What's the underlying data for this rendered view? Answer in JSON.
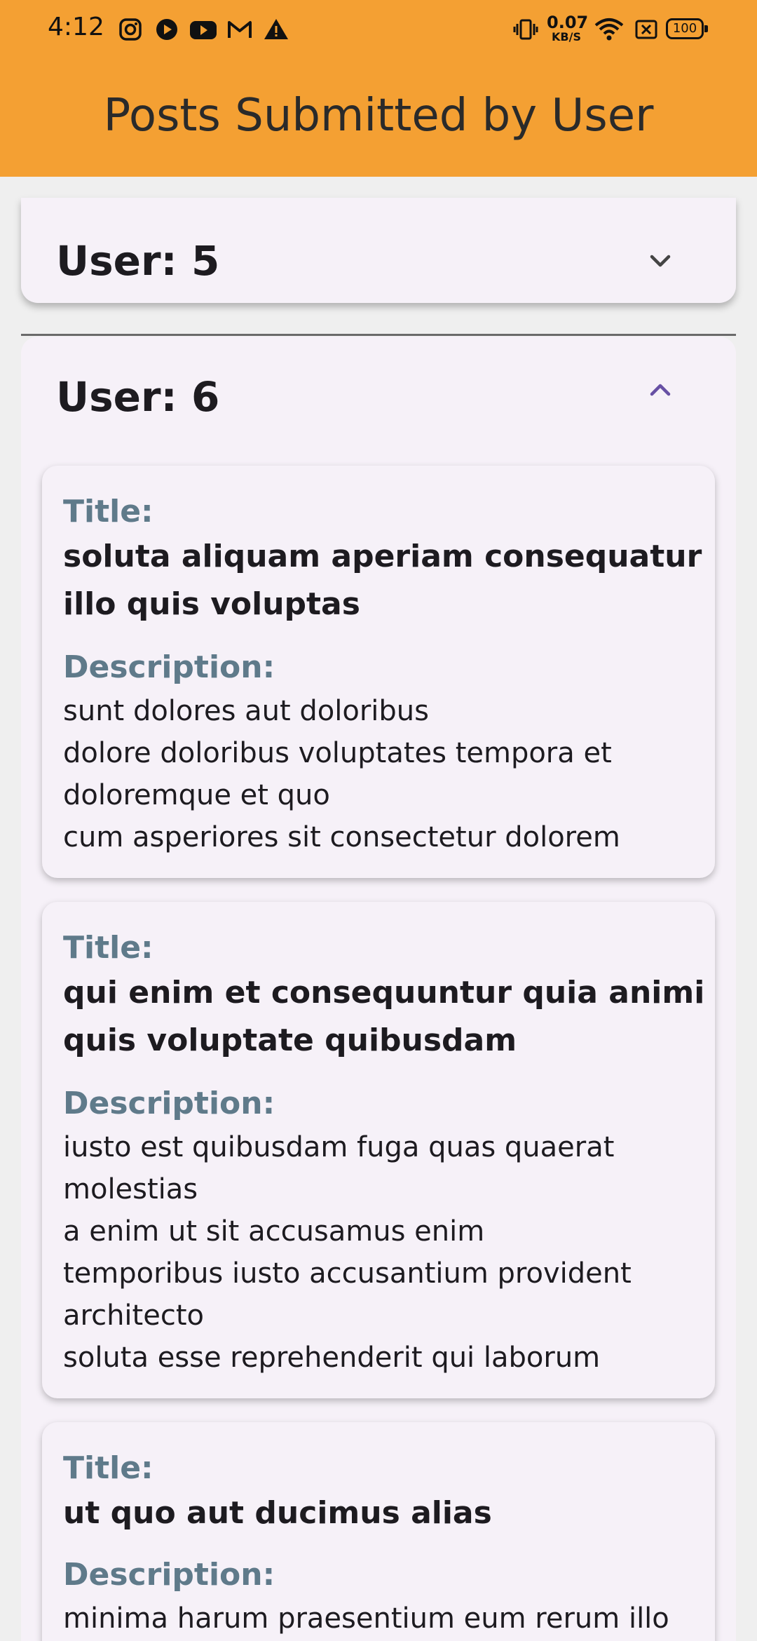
{
  "status_bar": {
    "time": "4:12",
    "network_speed": "0.07",
    "network_unit": "KB/S",
    "battery": "100"
  },
  "app_bar": {
    "title": "Posts Submitted by User"
  },
  "users": [
    {
      "label": "User: 5",
      "expanded": false
    },
    {
      "label": "User: 6",
      "expanded": true
    }
  ],
  "labels": {
    "title": "Title:",
    "description": "Description:"
  },
  "posts": [
    {
      "title": "soluta aliquam aperiam consequatur illo quis voluptas",
      "description": "sunt dolores aut doloribus\ndolore doloribus voluptates tempora et\ndoloremque et quo\ncum asperiores sit consectetur dolorem"
    },
    {
      "title": "qui enim et consequuntur quia animi quis voluptate quibusdam",
      "description": "iusto est quibusdam fuga quas quaerat\nmolestias\na enim ut sit accusamus enim\ntemporibus iusto accusantium provident\narchitecto\nsoluta esse reprehenderit qui laborum"
    },
    {
      "title": "ut quo aut ducimus alias",
      "description": "minima harum praesentium eum rerum illo"
    }
  ],
  "colors": {
    "app_bar": "#f4a033",
    "label": "#5f7a8a",
    "card": "#f6f1f8",
    "accent": "#6750a4"
  }
}
